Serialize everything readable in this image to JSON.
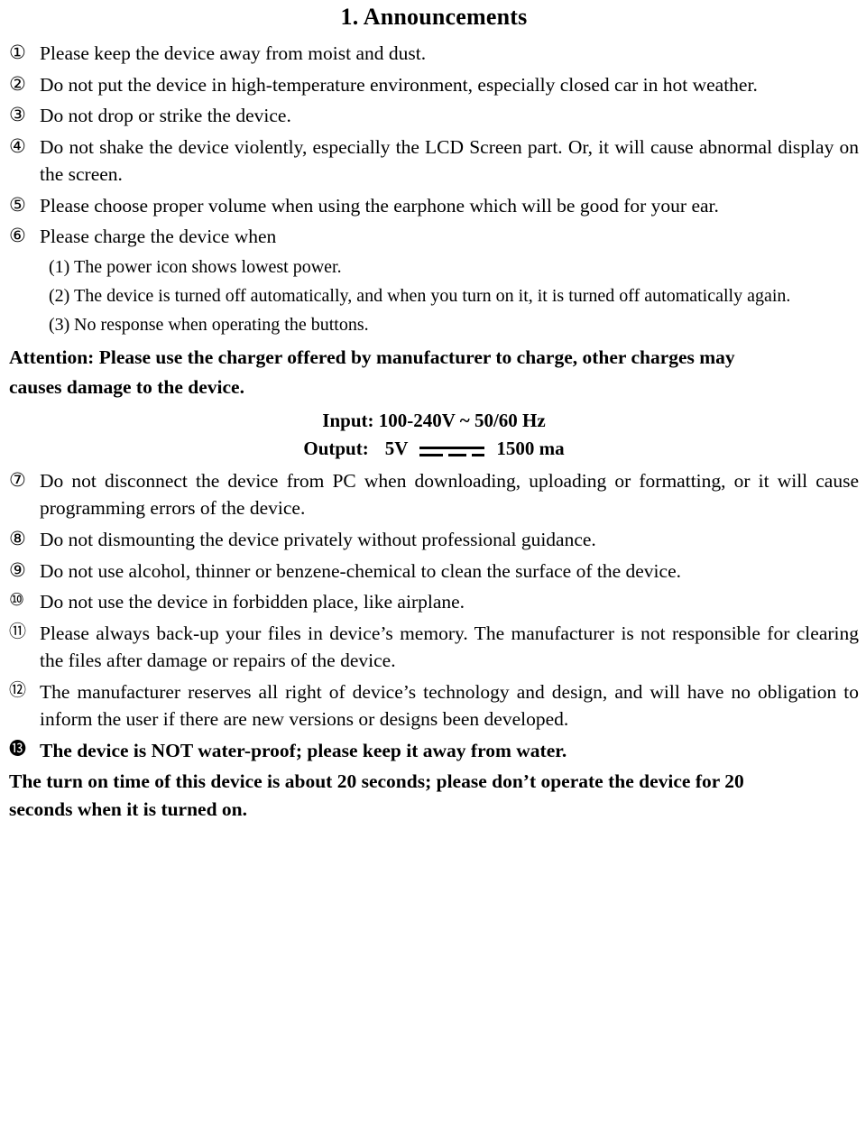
{
  "document": {
    "title": "1. Announcements",
    "items": [
      {
        "marker": "①",
        "text": "Please keep the device away from moist and dust."
      },
      {
        "marker": "②",
        "text": "Do not put the device in high-temperature environment, especially closed car in hot weather."
      },
      {
        "marker": "③",
        "text": "Do not drop or strike the device."
      },
      {
        "marker": "④",
        "text": "Do not shake the device violently, especially the LCD Screen part. Or, it will cause abnormal display on the screen."
      },
      {
        "marker": "⑤",
        "text": "Please choose proper volume when using the earphone which will be good for your ear."
      },
      {
        "marker": "⑥",
        "text": "Please charge the device when"
      }
    ],
    "sub_items": [
      {
        "marker": "(1)",
        "text": "The power icon shows lowest power."
      },
      {
        "marker": "(2)",
        "text": "The device is turned off automatically, and when you turn on it, it is turned off automatically again."
      },
      {
        "marker": "(3)",
        "text": "No response when operating the buttons."
      }
    ],
    "attention_line1": "Attention: Please use the charger offered by manufacturer to charge, other charges may",
    "attention_line2": "causes damage to the device.",
    "spec": {
      "input": "Input: 100-240V ~ 50/60 Hz",
      "output_label": "Output:",
      "output_voltage": "5V",
      "output_current": "1500 ma"
    },
    "items_after": [
      {
        "marker": "⑦",
        "text": "Do not disconnect the device from PC when downloading, uploading or formatting, or it will cause programming errors of the device.",
        "bold": false
      },
      {
        "marker": "⑧",
        "text": "Do not dismounting the device privately without professional guidance.",
        "bold": false
      },
      {
        "marker": "⑨",
        "text": "Do not use alcohol, thinner or benzene-chemical to clean the surface of the device.",
        "bold": false
      },
      {
        "marker": "⑩",
        "text": "Do not use the device in forbidden place, like airplane.",
        "bold": false
      },
      {
        "marker": "⑪",
        "text": "Please always back-up your files in device’s memory. The manufacturer is not responsible for clearing the files after damage or repairs of the device.",
        "bold": false
      },
      {
        "marker": "⑫",
        "text": "The manufacturer reserves all right of device’s technology and design, and will have no obligation to inform the user if there are new versions or designs been developed.",
        "bold": false
      },
      {
        "marker": "⓭",
        "text": "The device is NOT water-proof; please keep it away from water.",
        "bold": true
      }
    ],
    "closing_line1": "The turn on time of this device is about 20 seconds; please don’t operate the device for 20",
    "closing_line2": "seconds when it is turned on."
  }
}
